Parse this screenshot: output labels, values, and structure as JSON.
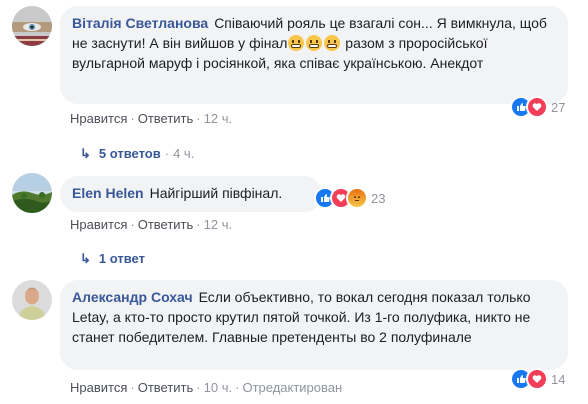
{
  "comments": [
    {
      "author": "Віталія Светланова",
      "text_part1": "Співаючий рояль це взагалі сон... Я вимкнула, щоб не заснути! А він вийшов у фінал",
      "text_part2": "разом з проросійської вульгарной маруф і росіянкой, яка співає українською. Анекдот",
      "emoji_name": "grinning-face-icon",
      "like": "Нравится",
      "reply": "Ответить",
      "time": "12 ч.",
      "reaction_count": "27",
      "replies_label": "5 ответов",
      "replies_time": "4 ч."
    },
    {
      "author": "Elen Helen",
      "text": "Найгірший півфінал.",
      "like": "Нравится",
      "reply": "Ответить",
      "time": "12 ч.",
      "reaction_count": "23",
      "replies_label": "1 ответ"
    },
    {
      "author": "Александр Сохач",
      "text": "Если объективно, то вокал сегодня показал только Letay, а кто-то просто крутил пятой точкой. Из 1-го полуфика, никто не станет победителем. Главные претенденты во 2 полуфинале",
      "like": "Нравится",
      "reply": "Ответить",
      "time": "10 ч.",
      "edited": "Отредактирован",
      "reaction_count": "14"
    }
  ],
  "colors": {
    "link_blue": "#385898",
    "bubble_bg": "#f2f3f5",
    "like_blue": "#1877f2",
    "love_red": "#f33e58",
    "angry_orange": "#e9710f"
  }
}
